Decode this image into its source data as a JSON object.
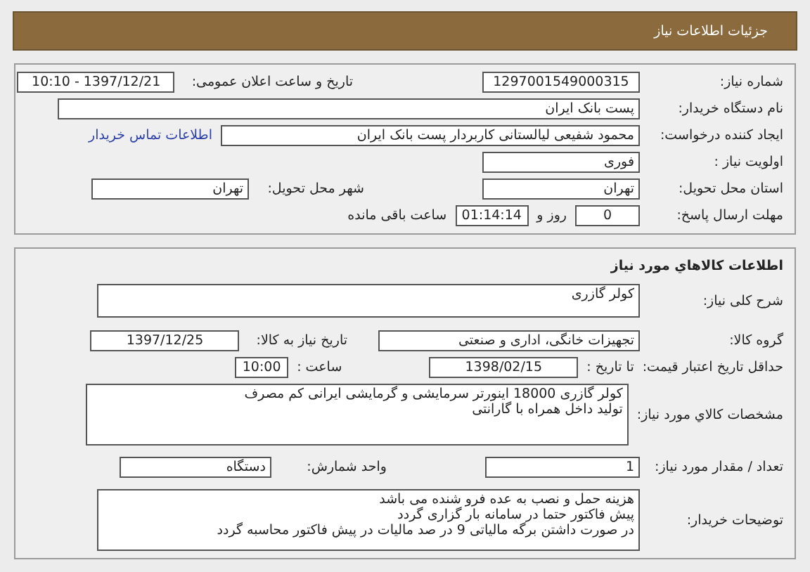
{
  "header": {
    "title": "جزئیات اطلاعات نیاز"
  },
  "request": {
    "number": {
      "label": "شماره نیاز:",
      "value": "1297001549000315"
    },
    "announce": {
      "label": "تاریخ و ساعت اعلان عمومی:",
      "value": "1397/12/21 - 10:10"
    },
    "buyer": {
      "label": "نام دستگاه خریدار:",
      "value": "پست بانک ایران"
    },
    "creator": {
      "label": "ایجاد کننده درخواست:",
      "value": "محمود شفیعی لیالستانی کاربردار پست بانک ایران"
    },
    "contact_link": "اطلاعات تماس خریدار",
    "priority": {
      "label": "اولویت نیاز :",
      "value": "فوری"
    },
    "province": {
      "label": "استان محل تحویل:",
      "value": "تهران"
    },
    "city": {
      "label": "شهر محل تحویل:",
      "value": "تهران"
    },
    "deadline": {
      "label": "مهلت ارسال پاسخ:",
      "days": "0",
      "days_suffix": "روز و",
      "time": "01:14:14",
      "time_suffix": "ساعت باقی مانده"
    }
  },
  "goods": {
    "title": "اطلاعات کالاهاي مورد نیاز",
    "summary": {
      "label": "شرح کلی نیاز:",
      "value": "کولر گازری"
    },
    "group": {
      "label": "گروه کالا:",
      "value": "تجهیزات خانگی، اداری و صنعتی"
    },
    "need_date": {
      "label": "تاریخ نیاز به کالا:",
      "value": "1397/12/25"
    },
    "validity": {
      "label": "حداقل تاریخ اعتبار قیمت:",
      "date_label": "تا تاریخ :",
      "date": "1398/02/15",
      "time_label": "ساعت :",
      "time": "10:00"
    },
    "specs": {
      "label": "مشخصات کالاي مورد نیاز:",
      "lines": [
        "کولر گازری 18000 اینورتر سرمایشی و گرمایشی ایرانی کم مصرف",
        "تولید داخل همراه با گارانتی"
      ]
    },
    "quantity": {
      "label": "تعداد / مقدار مورد نیاز:",
      "value": "1"
    },
    "unit": {
      "label": "واحد شمارش:",
      "value": "دستگاه"
    },
    "notes": {
      "label": "توضیحات خریدار:",
      "lines": [
        "هزینه حمل و نصب به عده فرو شنده می باشد",
        "پیش فاکتور حتما در سامانه بار گزاری گردد",
        "در صورت داشتن برگه مالیاتی 9 در صد مالیات در پیش فاکتور محاسبه گردد"
      ]
    }
  }
}
